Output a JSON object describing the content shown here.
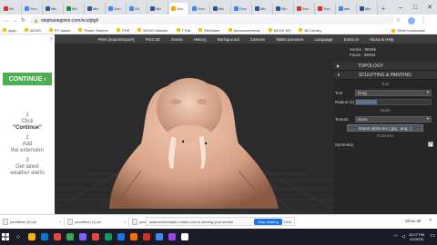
{
  "browser": {
    "tabs": [
      {
        "label": "Atl",
        "color": "#d93025"
      },
      {
        "label": "Goo",
        "color": "#4285f4"
      },
      {
        "label": "Mic",
        "color": "#2b579a"
      },
      {
        "label": "MC",
        "color": "#1e8e3e"
      },
      {
        "label": "Mic",
        "color": "#2b579a"
      },
      {
        "label": "Goo",
        "color": "#4285f4"
      },
      {
        "label": "Go",
        "color": "#4285f4"
      },
      {
        "label": "Mic",
        "color": "#2b579a"
      },
      {
        "label": "Scu",
        "color": "#f9ab00",
        "active": true
      },
      {
        "label": "Goo",
        "color": "#4285f4"
      },
      {
        "label": "Mic",
        "color": "#2b579a"
      },
      {
        "label": "Goo",
        "color": "#4285f4"
      },
      {
        "label": "Mic",
        "color": "#2b579a"
      },
      {
        "label": "Mic",
        "color": "#2b579a"
      },
      {
        "label": "Scu",
        "color": "#d93025"
      },
      {
        "label": "Goo",
        "color": "#d93025"
      },
      {
        "label": "ask",
        "color": "#4285f4"
      },
      {
        "label": "Mic",
        "color": "#2b579a"
      }
    ],
    "new_tab": "+",
    "window_controls": {
      "minimize": "–",
      "maximize": "□",
      "close": "✕"
    },
    "address": "stephaneginier.com/sculptgl/",
    "bookmarks": [
      "Apps",
      "MCHS",
      "PC admin",
      "Power Teacher",
      "PHS",
      "MCHS Website",
      "T Eat",
      "FileMaker",
      "Announcements",
      "MCHS W3",
      "BC Library",
      "Other bookmarks"
    ]
  },
  "ad": {
    "button_label": "CONTINUE ›",
    "steps": [
      {
        "num": "1",
        "line1": "Click",
        "line2": "\"Continue\""
      },
      {
        "num": "2",
        "line1": "Add",
        "line2": "the extension"
      },
      {
        "num": "3",
        "line1": "Get latest",
        "line2": "weather alerts"
      }
    ]
  },
  "app": {
    "menu": [
      "Files (import/export)",
      "Print 3D",
      "Scene",
      "History",
      "Background",
      "Camera",
      "Tablet pressure",
      "Language",
      "Extra UI",
      "About & Help"
    ],
    "stats": {
      "vertices": "Vertex : 98306",
      "faces": "Faces : 98304"
    },
    "panel": {
      "topology_header": "TOPOLOGY",
      "sculpt_header": "SCULPTING & PAINTING",
      "tool_section": "Tool",
      "tool_label": "Tool",
      "tool_value": "Drag",
      "radius_label": "Radius (X)",
      "radius_level": 0.28,
      "alpha_section": "Alpha",
      "texture_label": "Texture",
      "texture_value": "None",
      "import_button": "Import alpha tex (.jpg, .png...)",
      "common_section": "Common",
      "symmetry_label": "Symmetry",
      "symmetry_checked": "✓"
    }
  },
  "downloads": {
    "items": [
      "yourMesh (2).stl",
      "yourMesh (1).stl",
      "yourMesh.stl"
    ],
    "share_text": "www.screencast-o-matic.com is sharing your screen.",
    "stop_label": "Stop sharing",
    "hide_label": "Hide",
    "show_all": "Show all"
  },
  "taskbar": {
    "icons": [
      "#f4b400",
      "#0078d7",
      "#e8453c",
      "#34a853",
      "#7b61ff",
      "#e8453c",
      "#0f9d58",
      "#1a73e8",
      "#ff6d00",
      "#d93025",
      "#4285f4",
      "#a142f4",
      "#ffffff"
    ],
    "time": "10:27 PM",
    "date": "4/1/2020"
  }
}
